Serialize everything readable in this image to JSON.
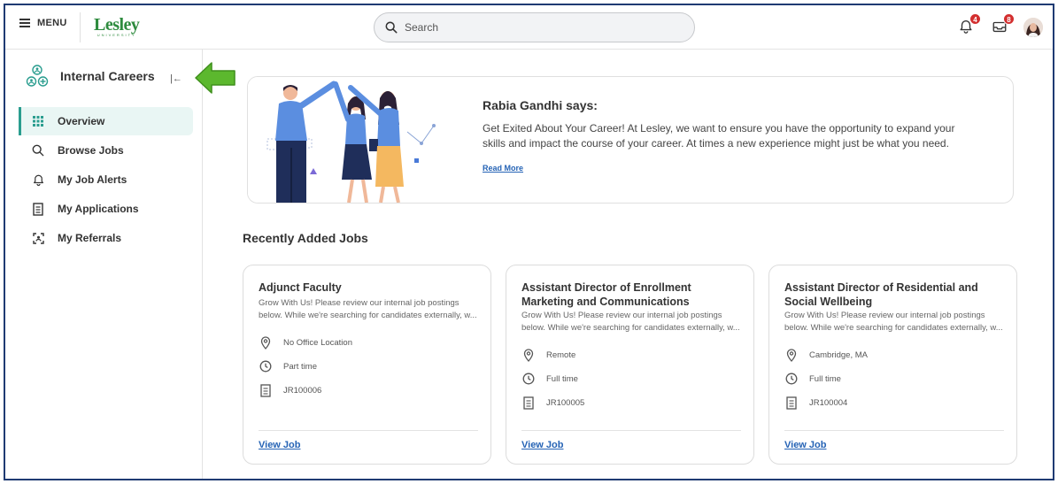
{
  "header": {
    "menu_label": "MENU",
    "logo_main": "Lesley",
    "logo_sub": "UNIVERSITY",
    "search_placeholder": "Search",
    "notifications_count": "4",
    "inbox_count": "8"
  },
  "sidebar": {
    "title": "Internal Careers",
    "collapse_glyph": "|←",
    "items": [
      {
        "label": "Overview",
        "icon": "grid-icon",
        "active": true
      },
      {
        "label": "Browse Jobs",
        "icon": "search-icon"
      },
      {
        "label": "My Job Alerts",
        "icon": "bell-icon"
      },
      {
        "label": "My Applications",
        "icon": "document-icon"
      },
      {
        "label": "My Referrals",
        "icon": "referral-icon"
      }
    ]
  },
  "banner": {
    "title": "Rabia Gandhi says:",
    "body": "Get Exited About Your Career! At Lesley, we want to ensure you have the opportunity to expand your skills and impact the course of your career. At times a new experience might just be what you need.",
    "link": "Read More"
  },
  "recent": {
    "title": "Recently Added Jobs",
    "jobs": [
      {
        "title": "Adjunct Faculty",
        "desc_line1": "Grow With Us! Please review our internal job postings",
        "desc_line2": "below. While we're searching for candidates externally, w...",
        "location": "No Office Location",
        "time": "Part time",
        "id": "JR100006",
        "link": "View Job"
      },
      {
        "title": "Assistant Director of Enrollment Marketing and Communications",
        "desc_line1": "Grow With Us! Please review our internal job postings",
        "desc_line2": "below. While we're searching for candidates externally, w...",
        "location": "Remote",
        "time": "Full time",
        "id": "JR100005",
        "link": "View Job"
      },
      {
        "title": "Assistant Director of Residential and Social Wellbeing",
        "desc_line1": "Grow With Us! Please review our internal job postings",
        "desc_line2": "below. While we're searching for candidates externally, w...",
        "location": "Cambridge, MA",
        "time": "Full time",
        "id": "JR100004",
        "link": "View Job"
      }
    ]
  },
  "colors": {
    "accent_green": "#2e8b3e",
    "active_teal": "#2a9d8f",
    "link_blue": "#2563b5",
    "badge_red": "#d32f2f",
    "arrow_green": "#5cb82e"
  }
}
